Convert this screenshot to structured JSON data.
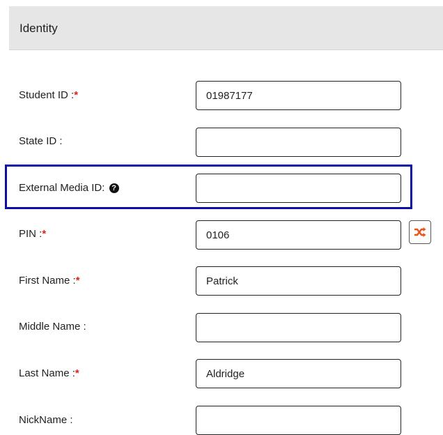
{
  "section": {
    "title": "Identity"
  },
  "fields": {
    "student_id": {
      "label": "Student ID :",
      "required_mark": "*",
      "value": "01987177"
    },
    "state_id": {
      "label": "State ID :",
      "value": ""
    },
    "external_media_id": {
      "label": "External Media ID:",
      "help_icon": "question-circle-icon",
      "value": ""
    },
    "pin": {
      "label": "PIN :",
      "required_mark": "*",
      "value": "0106",
      "action_icon": "shuffle-icon"
    },
    "first_name": {
      "label": "First Name :",
      "required_mark": "*",
      "value": "Patrick"
    },
    "middle_name": {
      "label": "Middle Name :",
      "value": ""
    },
    "last_name": {
      "label": "Last Name :",
      "required_mark": "*",
      "value": "Aldridge"
    },
    "nickname": {
      "label": "NickName :",
      "value": ""
    }
  },
  "colors": {
    "required": "#e0201b",
    "highlight_border": "#0c0fa6",
    "shuffle_icon": "#e8541c",
    "header_bg": "#e6e6e6"
  }
}
